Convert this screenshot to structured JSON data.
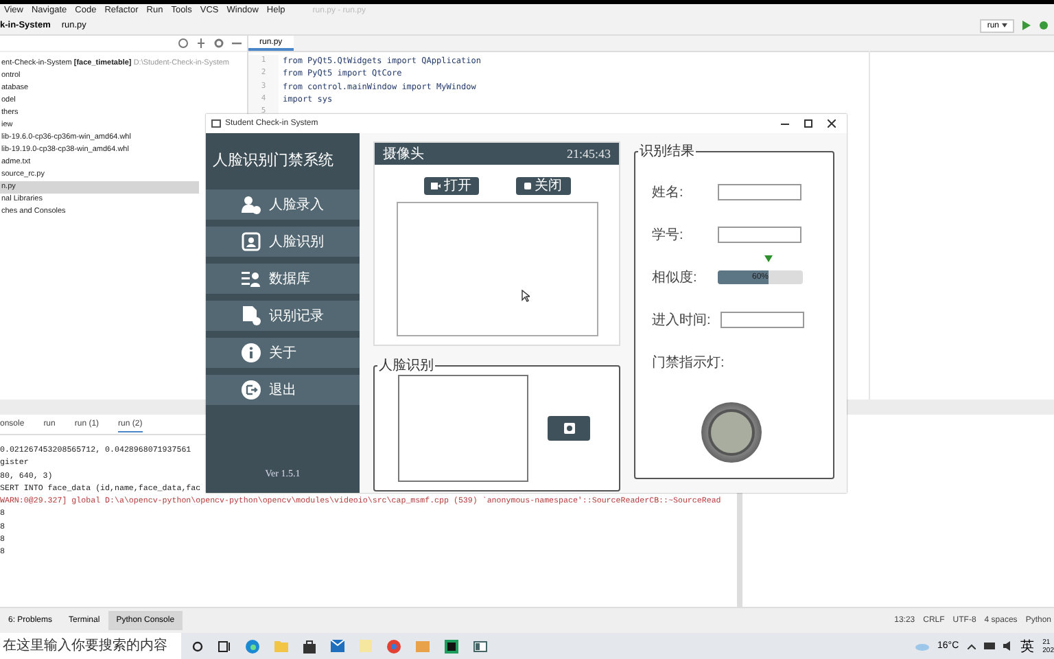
{
  "ide": {
    "menu": [
      "View",
      "Navigate",
      "Code",
      "Refactor",
      "Run",
      "Tools",
      "VCS",
      "Window",
      "Help"
    ],
    "title": "run.py - run.py",
    "breadcrumb": {
      "project": "k-in-System",
      "file": "run.py"
    },
    "run_config": "run",
    "project_tree": [
      {
        "label": "ent-Check-in-System",
        "branch": "[face_timetable]",
        "path": "D:\\Student-Check-in-System",
        "selected": false
      },
      {
        "label": "ontrol",
        "selected": false
      },
      {
        "label": "atabase",
        "selected": false
      },
      {
        "label": "odel",
        "selected": false
      },
      {
        "label": "thers",
        "selected": false
      },
      {
        "label": "iew",
        "selected": false
      },
      {
        "label": "lib-19.6.0-cp36-cp36m-win_amd64.whl",
        "selected": false
      },
      {
        "label": "lib-19.19.0-cp38-cp38-win_amd64.whl",
        "selected": false
      },
      {
        "label": "adme.txt",
        "selected": false
      },
      {
        "label": "source_rc.py",
        "selected": false
      },
      {
        "label": "n.py",
        "selected": true
      },
      {
        "label": "nal Libraries",
        "selected": false
      },
      {
        "label": "ches and Consoles",
        "selected": false
      }
    ],
    "editor": {
      "tab": "run.py",
      "lines": [
        {
          "number": "1",
          "code": "from PyQt5.QtWidgets import QApplication"
        },
        {
          "number": "2",
          "code": "from PyQt5 import QtCore"
        },
        {
          "number": "3",
          "code": "from control.mainWindow import MyWindow"
        },
        {
          "number": "4",
          "code": "import sys"
        },
        {
          "number": "5"
        }
      ]
    },
    "run_panel": {
      "tabs": [
        {
          "label": "onsole",
          "selected": false
        },
        {
          "label": "run",
          "selected": false
        },
        {
          "label": "run (1)",
          "selected": false
        },
        {
          "label": "run (2)",
          "selected": true
        }
      ],
      "output": [
        {
          "kind": "normal",
          "text": "0.021267453208565712, 0.0428968071937561"
        },
        {
          "kind": "normal",
          "text": "gister"
        },
        {
          "kind": "normal",
          "text": "80, 640, 3)"
        },
        {
          "kind": "normal",
          "text": "SERT INTO face_data (id,name,face_data,fac"
        },
        {
          "kind": "warning",
          "text": "WARN:0@29.327] global D:\\a\\opencv-python\\opencv-python\\opencv\\modules\\videoio\\src\\cap_msmf.cpp (539) `anonymous-namespace'::SourceReaderCB::~SourceRead"
        },
        {
          "kind": "normal",
          "text": "8"
        },
        {
          "kind": "normal",
          "text": "8"
        },
        {
          "kind": "normal",
          "text": "8"
        },
        {
          "kind": "normal",
          "text": "8"
        }
      ]
    },
    "tool_tabs": [
      {
        "label": "6: Problems",
        "selected": false
      },
      {
        "label": "Terminal",
        "selected": false
      },
      {
        "label": "Python Console",
        "selected": true
      }
    ],
    "status": [
      "13:23",
      "CRLF",
      "UTF-8",
      "4 spaces",
      "Python"
    ]
  },
  "app": {
    "title": "Student Check-in System",
    "heading": "人脸识别门禁系统",
    "nav": [
      {
        "label": "人脸录入"
      },
      {
        "label": "人脸识别"
      },
      {
        "label": "数据库"
      },
      {
        "label": "识别记录"
      },
      {
        "label": "关于"
      },
      {
        "label": "退出"
      }
    ],
    "version": "Ver 1.5.1",
    "camera": {
      "title": "摄像头",
      "time": "21:45:43",
      "buttons": [
        "打开",
        "关闭"
      ]
    },
    "recognition": {
      "title": "人脸识别"
    },
    "result": {
      "title": "识别结果",
      "fields": [
        {
          "kind": "text",
          "label": "姓名:"
        },
        {
          "kind": "text",
          "label": "学号:"
        },
        {
          "kind": "meter",
          "label": "相似度:",
          "level": 0.6,
          "reading": "60%"
        },
        {
          "kind": "text",
          "label": "进入时间:"
        },
        {
          "kind": "lamp",
          "label": "门禁指示灯:",
          "on": false
        }
      ]
    }
  },
  "taskbar": {
    "search": {
      "placeholder": "在这里输入你要搜索的内容"
    },
    "weather": "16°C",
    "ime": "英",
    "clock": {
      "time": "21",
      "date": "202"
    }
  }
}
